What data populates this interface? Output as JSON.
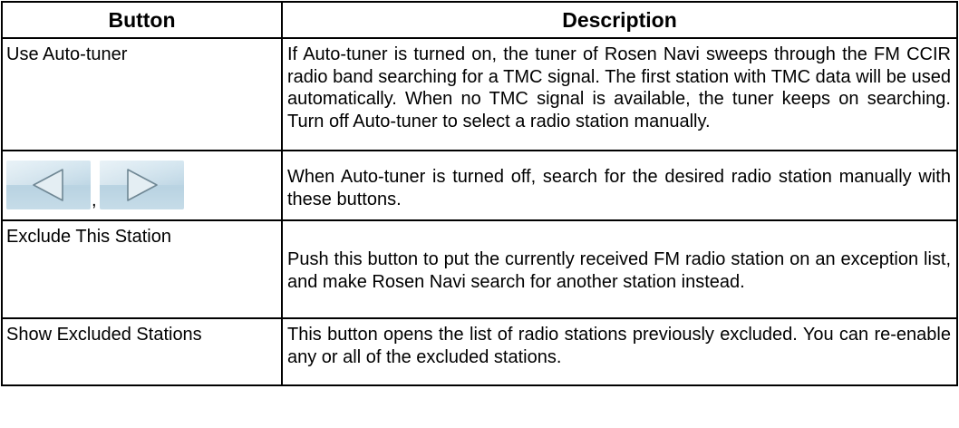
{
  "header": {
    "col_button": "Button",
    "col_description": "Description"
  },
  "rows": [
    {
      "button": "Use Auto-tuner",
      "description": "If Auto-tuner is turned on, the tuner of Rosen Navi sweeps through the FM CCIR radio band searching for a TMC signal. The first station with TMC data will be used automatically. When no TMC signal is available, the tuner keeps on searching. Turn off Auto-tuner to select a radio station manually."
    },
    {
      "button_icons": [
        "left-arrow-icon",
        "right-arrow-icon"
      ],
      "separator": ",",
      "description": "When Auto-tuner is turned off, search for the desired radio station manually with these buttons."
    },
    {
      "button": "Exclude This Station",
      "description": "Push this button to put the currently received FM radio station on an exception list, and make Rosen Navi search for another station instead."
    },
    {
      "button": "Show Excluded Stations",
      "description": "This button opens the list of radio stations previously excluded. You can re-enable any or all of the excluded stations."
    }
  ]
}
